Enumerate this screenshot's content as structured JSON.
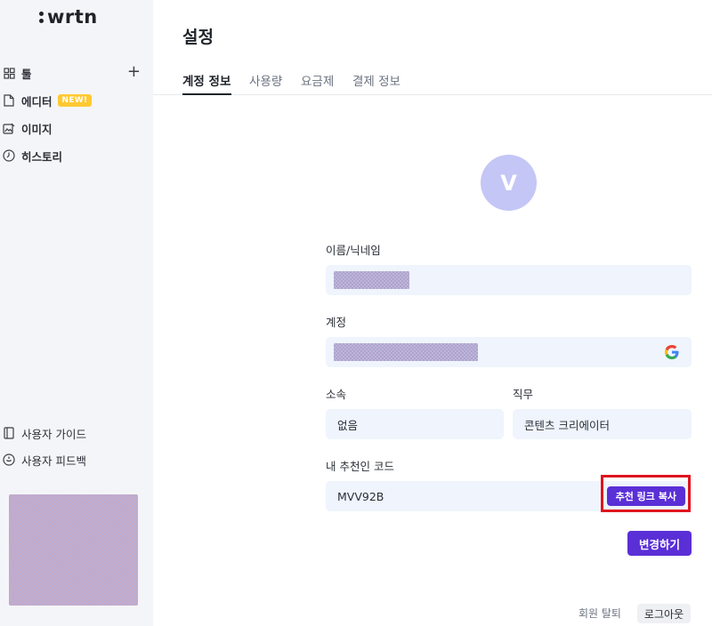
{
  "brand": {
    "name": "wrtn"
  },
  "sidebar": {
    "items": [
      {
        "label": "툴",
        "icon": "grid-icon"
      },
      {
        "label": "에디터",
        "icon": "document-icon",
        "badge": "NEW!"
      },
      {
        "label": "이미지",
        "icon": "image-edit-icon"
      },
      {
        "label": "히스토리",
        "icon": "clock-icon"
      }
    ],
    "add_icon": "plus-icon",
    "footer": [
      {
        "label": "사용자 가이드",
        "icon": "book-icon"
      },
      {
        "label": "사용자 피드백",
        "icon": "feedback-icon"
      }
    ]
  },
  "page": {
    "title": "설정"
  },
  "tabs": [
    {
      "label": "계정 정보",
      "active": true
    },
    {
      "label": "사용량",
      "active": false
    },
    {
      "label": "요금제",
      "active": false
    },
    {
      "label": "결제 정보",
      "active": false
    }
  ],
  "profile": {
    "avatar_initial": "V"
  },
  "form": {
    "name_label": "이름/닉네임",
    "account_label": "계정",
    "affiliation_label": "소속",
    "affiliation_value": "없음",
    "job_label": "직무",
    "job_value": "콘텐츠 크리에이터",
    "referral_label": "내 추천인 코드",
    "referral_code": "MVV92B",
    "copy_link_label": "추천 링크 복사",
    "submit_label": "변경하기"
  },
  "account_actions": {
    "withdraw_label": "회원 탈퇴",
    "logout_label": "로그아웃"
  },
  "colors": {
    "accent": "#5a2fd6",
    "highlight": "#e0141e",
    "badge": "#ffc933",
    "avatar": "#c4c6f6",
    "field_bg": "#eff4fd"
  }
}
